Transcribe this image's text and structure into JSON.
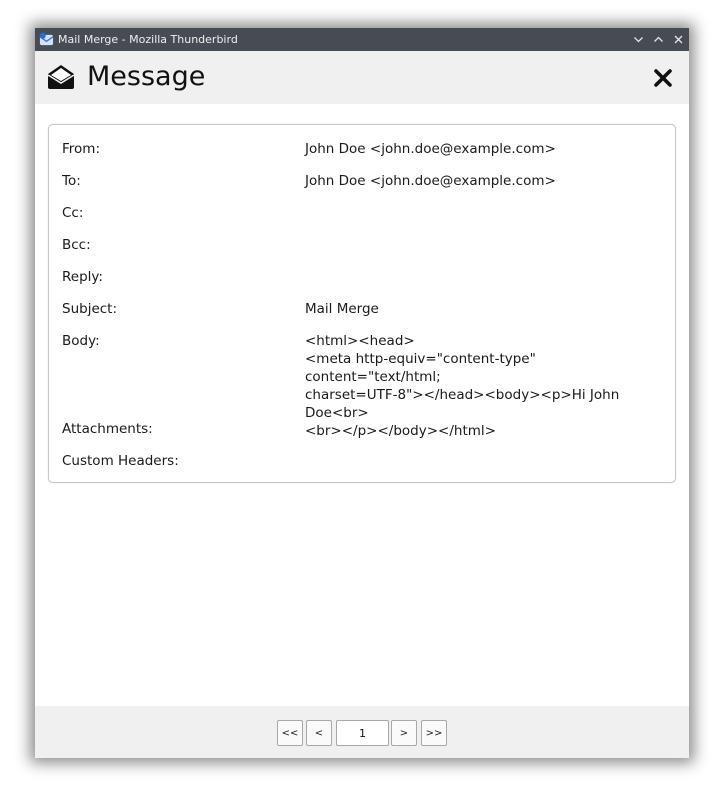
{
  "window": {
    "title": "Mail Merge - Mozilla Thunderbird"
  },
  "header": {
    "title": "Message"
  },
  "message": {
    "fields": [
      {
        "label": "From:",
        "value": "John Doe <john.doe@example.com>"
      },
      {
        "label": "To:",
        "value": "John Doe <john.doe@example.com>"
      },
      {
        "label": "Cc:",
        "value": ""
      },
      {
        "label": "Bcc:",
        "value": ""
      },
      {
        "label": "Reply:",
        "value": ""
      },
      {
        "label": "Subject:",
        "value": "Mail Merge"
      },
      {
        "label": "Body:",
        "value": ""
      },
      {
        "label": "Attachments:",
        "value": ""
      },
      {
        "label": "Custom Headers:",
        "value": ""
      }
    ],
    "body_lines": [
      "<html><head>",
      "<meta http-equiv=\"content-type\" content=\"text/html;",
      "charset=UTF-8\"></head><body><p>Hi John Doe<br>",
      "<br></p></body></html>"
    ]
  },
  "pagination": {
    "first": "<<",
    "prev": "<",
    "page": "1",
    "next": ">",
    "last": ">>"
  },
  "colors": {
    "titlebar": "#474c54",
    "header_bg": "#f0f0f0"
  }
}
